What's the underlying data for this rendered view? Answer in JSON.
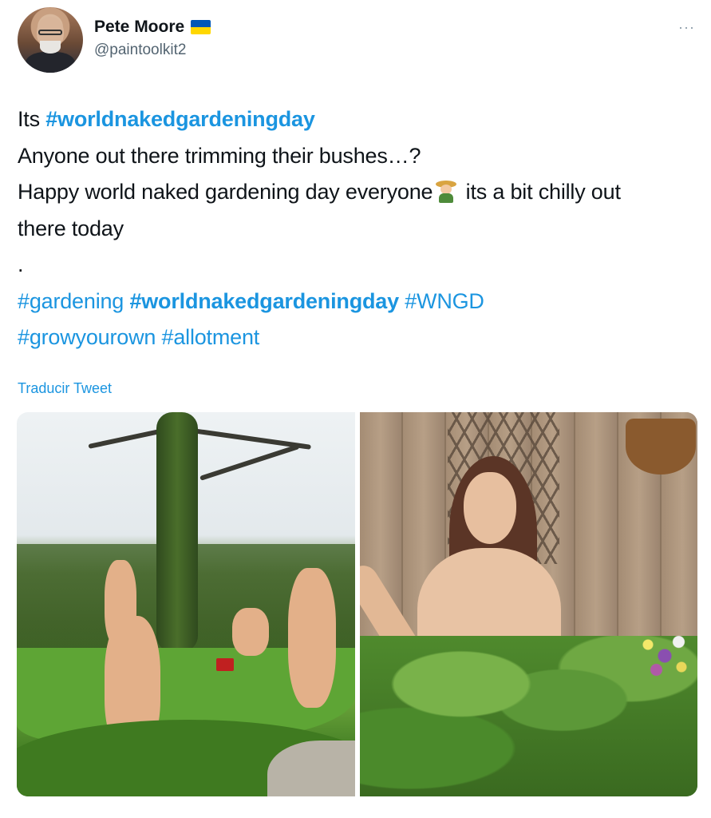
{
  "author": {
    "name": "Pete Moore",
    "handle": "@paintoolkit2",
    "flag": "ukraine-flag"
  },
  "more_menu": "···",
  "tweet": {
    "line1_prefix": "Its ",
    "line1_tag": "#worldnakedgardeningday",
    "line2": "Anyone out there trimming their bushes…?",
    "line3_before": "Happy world naked gardening day everyone",
    "line3_emoji": "farmer-emoji",
    "line3_after": " its a bit chilly out",
    "line4": "there today",
    "line5": ".",
    "tags_line1": [
      "#gardening",
      "#worldnakedgardeningday",
      "#WNGD"
    ],
    "tags_line2": [
      "#growyourown",
      "#allotment"
    ]
  },
  "translate_label": "Traducir Tweet",
  "colors": {
    "link": "#1b95e0",
    "text": "#0f1419",
    "secondary": "#536471"
  },
  "media": [
    {
      "name": "photo-garden-men"
    },
    {
      "name": "photo-woman-fence"
    }
  ]
}
